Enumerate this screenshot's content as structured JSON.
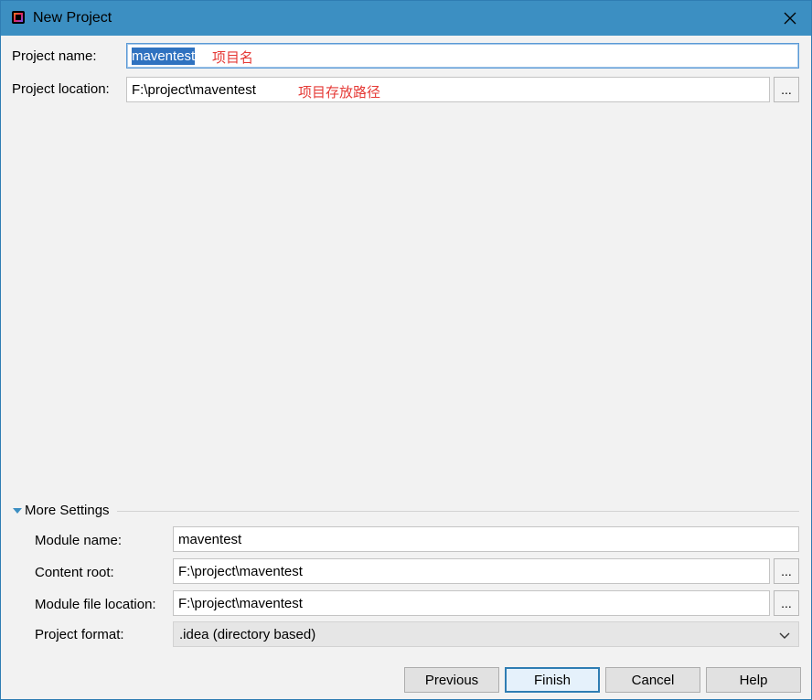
{
  "window": {
    "title": "New Project",
    "app_icon": "intellij-idea-icon",
    "close_icon": "close-icon"
  },
  "project": {
    "name_label": "Project name:",
    "name_value": "maventest",
    "name_annotation": "项目名",
    "location_label": "Project location:",
    "location_value": "F:\\project\\maventest",
    "location_annotation": "项目存放路径",
    "browse_label": "..."
  },
  "more_settings": {
    "header": "More Settings",
    "module_name_label": "Module name:",
    "module_name_value": "maventest",
    "content_root_label": "Content root:",
    "content_root_value": "F:\\project\\maventest",
    "module_file_location_label": "Module file location:",
    "module_file_location_value": "F:\\project\\maventest",
    "project_format_label": "Project format:",
    "project_format_value": ".idea (directory based)",
    "browse_label": "..."
  },
  "buttons": {
    "previous": "Previous",
    "finish": "Finish",
    "cancel": "Cancel",
    "help": "Help"
  },
  "colors": {
    "titlebar": "#3c8fc2",
    "annotation": "#e53935",
    "selection": "#2f72c0"
  }
}
